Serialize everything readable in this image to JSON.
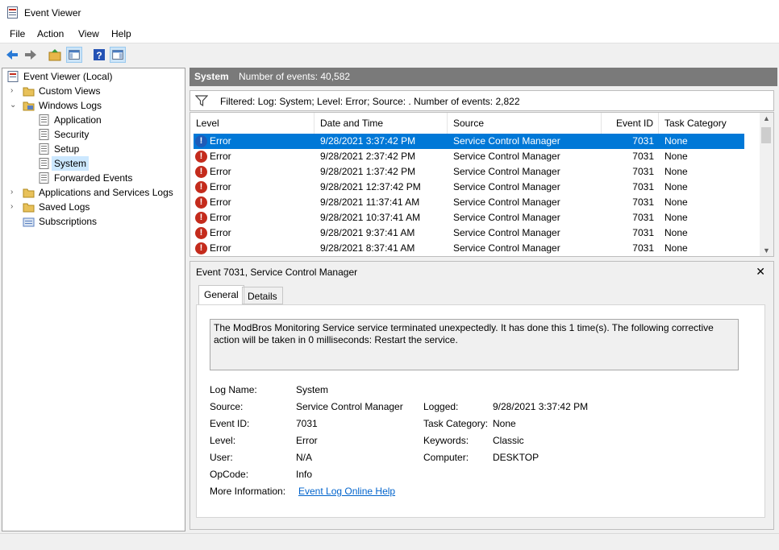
{
  "window": {
    "title": "Event Viewer"
  },
  "menu": [
    "File",
    "Action",
    "View",
    "Help"
  ],
  "toolbar": {
    "buttons": [
      "back-icon",
      "forward-icon",
      "up-folder-icon",
      "show-hide-tree-icon",
      "help-icon",
      "show-action-pane-icon"
    ]
  },
  "tree": {
    "root": "Event Viewer (Local)",
    "custom_views": "Custom Views",
    "windows_logs": "Windows Logs",
    "application": "Application",
    "security": "Security",
    "setup": "Setup",
    "system": "System",
    "forwarded": "Forwarded Events",
    "app_services": "Applications and Services Logs",
    "saved_logs": "Saved Logs",
    "subscriptions": "Subscriptions"
  },
  "log_header": {
    "name": "System",
    "count": "Number of events: 40,582"
  },
  "filter": "Filtered: Log: System; Level: Error; Source: . Number of events: 2,822",
  "columns": [
    "Level",
    "Date and Time",
    "Source",
    "Event ID",
    "Task Category"
  ],
  "events": [
    {
      "level": "Error",
      "date": "9/28/2021 3:37:42 PM",
      "source": "Service Control Manager",
      "id": "7031",
      "task": "None"
    },
    {
      "level": "Error",
      "date": "9/28/2021 2:37:42 PM",
      "source": "Service Control Manager",
      "id": "7031",
      "task": "None"
    },
    {
      "level": "Error",
      "date": "9/28/2021 1:37:42 PM",
      "source": "Service Control Manager",
      "id": "7031",
      "task": "None"
    },
    {
      "level": "Error",
      "date": "9/28/2021 12:37:42 PM",
      "source": "Service Control Manager",
      "id": "7031",
      "task": "None"
    },
    {
      "level": "Error",
      "date": "9/28/2021 11:37:41 AM",
      "source": "Service Control Manager",
      "id": "7031",
      "task": "None"
    },
    {
      "level": "Error",
      "date": "9/28/2021 10:37:41 AM",
      "source": "Service Control Manager",
      "id": "7031",
      "task": "None"
    },
    {
      "level": "Error",
      "date": "9/28/2021 9:37:41 AM",
      "source": "Service Control Manager",
      "id": "7031",
      "task": "None"
    },
    {
      "level": "Error",
      "date": "9/28/2021 8:37:41 AM",
      "source": "Service Control Manager",
      "id": "7031",
      "task": "None"
    }
  ],
  "details": {
    "title": "Event 7031, Service Control Manager",
    "tabs": [
      "General",
      "Details"
    ],
    "description": "The ModBros Monitoring Service service terminated unexpectedly.  It has done this 1 time(s).  The following corrective action will be taken in 0 milliseconds: Restart the service.",
    "labels": {
      "log_name": "Log Name:",
      "source": "Source:",
      "event_id": "Event ID:",
      "level": "Level:",
      "user": "User:",
      "opcode": "OpCode:",
      "more_info": "More Information:",
      "logged": "Logged:",
      "task_category": "Task Category:",
      "keywords": "Keywords:",
      "computer": "Computer:"
    },
    "values": {
      "log_name": "System",
      "source": "Service Control Manager",
      "event_id": "7031",
      "level": "Error",
      "user": "N/A",
      "opcode": "Info",
      "more_info_link": "Event Log Online Help",
      "logged": "9/28/2021 3:37:42 PM",
      "task_category": "None",
      "keywords": "Classic",
      "computer": "DESKTOP"
    }
  },
  "colors": {
    "selection": "#0078d7",
    "error": "#c42b1c",
    "header": "#7a7a7a",
    "tree_selection": "#cce8ff"
  }
}
